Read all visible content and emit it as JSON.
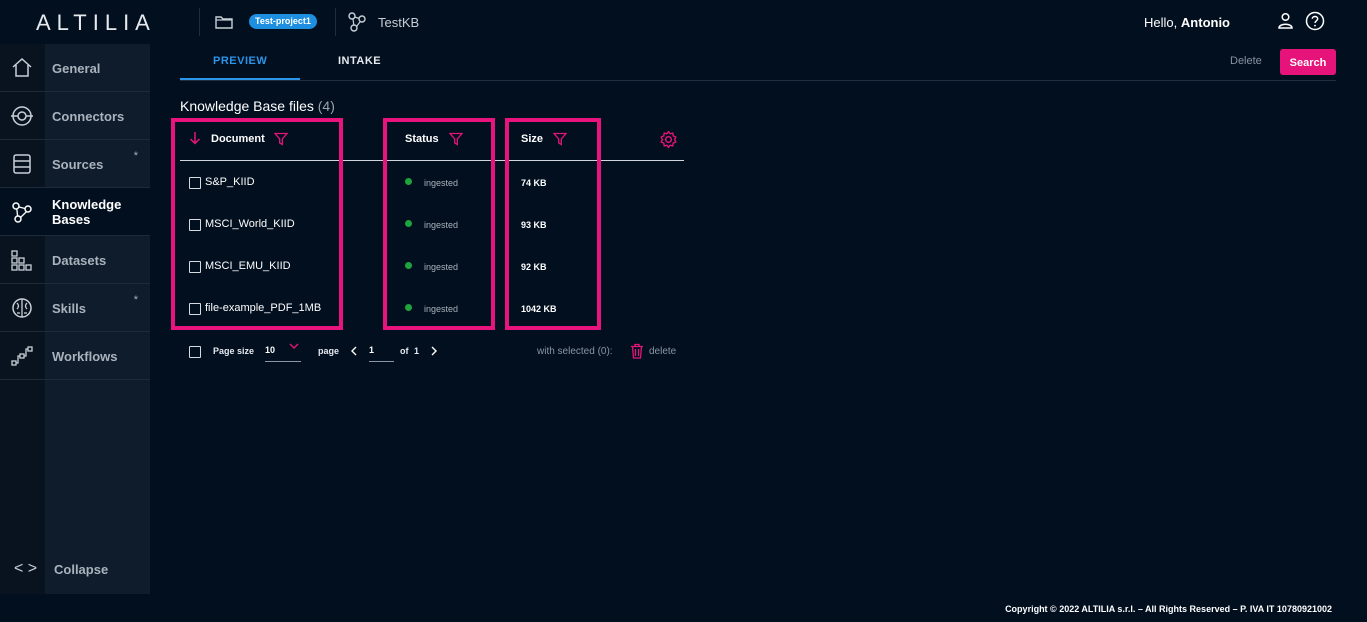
{
  "app": {
    "logo": "ALTILIA",
    "project": "Test-project1",
    "kb_name": "TestKB"
  },
  "user": {
    "greeting": "Hello,",
    "name": "Antonio"
  },
  "sidebar": {
    "items": [
      {
        "label": "General",
        "icon": "home-icon"
      },
      {
        "label": "Connectors",
        "icon": "connector-icon"
      },
      {
        "label": "Sources",
        "icon": "database-icon",
        "badge": "*"
      },
      {
        "label_line1": "Knowledge",
        "label_line2": "Bases",
        "icon": "graph-icon",
        "active": true
      },
      {
        "label": "Datasets",
        "icon": "grid-icon"
      },
      {
        "label": "Skills",
        "icon": "brain-icon",
        "badge": "*"
      },
      {
        "label": "Workflows",
        "icon": "workflow-icon"
      }
    ],
    "collapse_label": "Collapse"
  },
  "tabs": {
    "preview": "PREVIEW",
    "intake": "INTAKE",
    "active": "PREVIEW"
  },
  "toolbar": {
    "delete_label": "Delete",
    "search_label": "Search"
  },
  "section": {
    "title": "Knowledge Base files",
    "count": "(4)"
  },
  "table": {
    "columns": {
      "document": "Document",
      "status": "Status",
      "size": "Size"
    },
    "rows": [
      {
        "document": "S&P_KIID",
        "status": "ingested",
        "size": "74 KB"
      },
      {
        "document": "MSCI_World_KIID",
        "status": "ingested",
        "size": "93 KB"
      },
      {
        "document": "MSCI_EMU_KIID",
        "status": "ingested",
        "size": "92 KB"
      },
      {
        "document": "file-example_PDF_1MB",
        "status": "ingested",
        "size": "1042 KB"
      }
    ]
  },
  "pagination": {
    "page_size_label": "Page size",
    "page_size_value": "10",
    "page_label": "page",
    "current_page": "1",
    "of_label": "of",
    "total_pages": "1",
    "with_selected": "with selected (0):",
    "delete_label": "delete"
  },
  "footer": {
    "copyright": "Copyright © 2022 ALTILIA s.r.l. – All Rights Reserved – P. IVA IT 10780921002"
  },
  "colors": {
    "accent": "#e6147a",
    "primary": "#2b95e9",
    "ingested": "#1fa33c",
    "background": "#020f1f"
  }
}
